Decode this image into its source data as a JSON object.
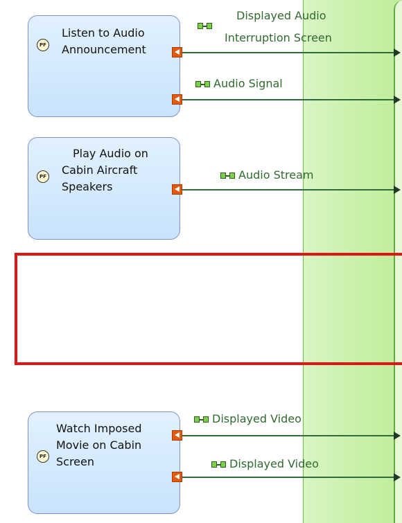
{
  "functions": [
    {
      "id": "f1",
      "icon_text": "PF",
      "label_lines": [
        "Listen to Audio",
        "Announcement"
      ]
    },
    {
      "id": "f2",
      "icon_text": "PF",
      "label_lines": [
        "Play Audio on",
        "Cabin Aircraft",
        "Speakers"
      ]
    },
    {
      "id": "f3",
      "icon_text": "PF",
      "label_lines": [
        "Watch Imposed",
        "Movie on Cabin",
        "Screen"
      ]
    }
  ],
  "exchanges": [
    {
      "id": "e1",
      "label_lines": [
        "Displayed Audio",
        "Interruption Screen"
      ]
    },
    {
      "id": "e2",
      "label": "Audio Signal"
    },
    {
      "id": "e3",
      "label": "Audio Stream"
    },
    {
      "id": "e4",
      "label": "Displayed Video"
    },
    {
      "id": "e5",
      "label": "Displayed Video"
    }
  ],
  "colors": {
    "function_fill": "#cfe6fc",
    "function_border": "#7f90c9",
    "port": "#e35a0f",
    "exchange_line": "#2f6b3a",
    "exchange_label": "#2f6a2f",
    "lane": "#c8f0a8",
    "highlight": "#e11313"
  }
}
